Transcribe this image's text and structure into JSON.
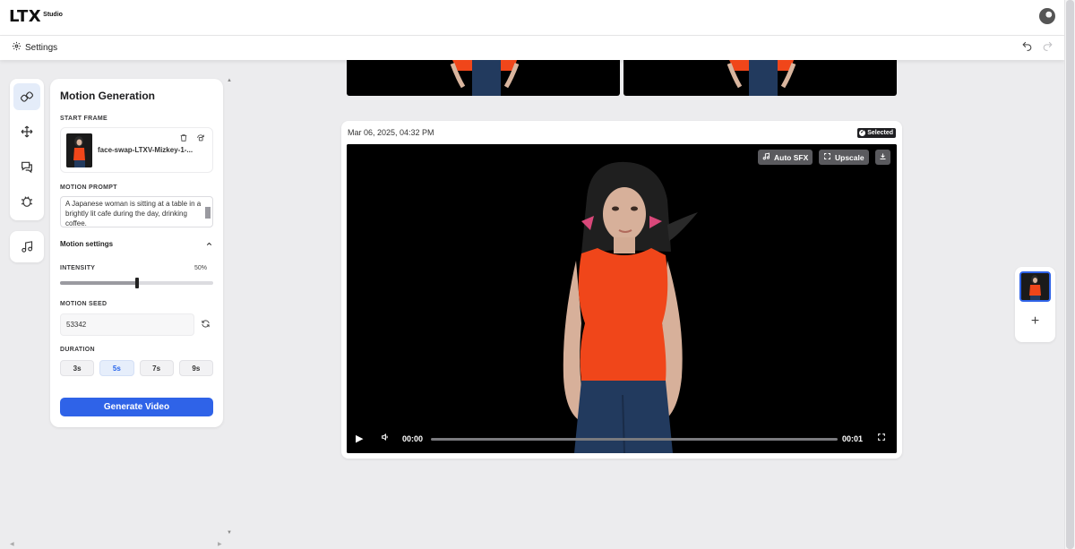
{
  "header": {
    "logo_main": "LTX",
    "logo_sub": "Studio",
    "settings_label": "Settings",
    "undo_icon": "undo-icon",
    "redo_icon": "redo-icon"
  },
  "rail": {
    "tools": [
      "link-icon",
      "move-icon",
      "chat-icon",
      "bug-icon"
    ],
    "music_icon": "music-icon"
  },
  "panel": {
    "title": "Motion Generation",
    "start_frame_label": "START FRAME",
    "start_frame_name": "face-swap-LTXV-Mizkey-1-...",
    "motion_prompt_label": "MOTION PROMPT",
    "motion_prompt": "A Japanese woman is sitting at a table in a brightly lit cafe during the day, drinking coffee.",
    "motion_settings_label": "Motion settings",
    "intensity_label": "INTENSITY",
    "intensity_value": "50%",
    "intensity_fraction": 0.5,
    "motion_seed_label": "MOTION SEED",
    "motion_seed": "53342",
    "duration_label": "DURATION",
    "durations": [
      "3s",
      "5s",
      "7s",
      "9s"
    ],
    "selected_duration": "5s",
    "generate_label": "Generate Video"
  },
  "video_card": {
    "date": "Mar 06, 2025, 04:32 PM",
    "badge": "Selected",
    "auto_sfx_label": "Auto SFX",
    "upscale_label": "Upscale",
    "current_time": "00:00",
    "end_time": "00:01",
    "progress_fraction": 0.0
  },
  "colors": {
    "accent": "#2f63e8",
    "top_shirt": "#f0461a",
    "pants": "#223a5e"
  }
}
